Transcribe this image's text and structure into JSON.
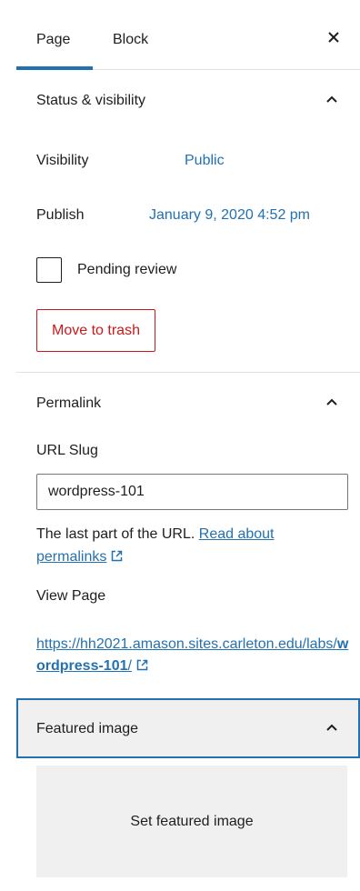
{
  "tabs": {
    "page_label": "Page",
    "block_label": "Block"
  },
  "status_panel": {
    "title": "Status & visibility",
    "visibility_label": "Visibility",
    "visibility_value": "Public",
    "publish_label": "Publish",
    "publish_value": "January 9, 2020 4:52 pm",
    "pending_review_label": "Pending review",
    "pending_review_checked": false,
    "trash_button": "Move to trash"
  },
  "permalink_panel": {
    "title": "Permalink",
    "url_slug_label": "URL Slug",
    "url_slug_value": "wordpress-101",
    "help_text": "The last part of the URL.",
    "help_link": "Read about permalinks",
    "view_page_label": "View Page",
    "url_base": "https://hh2021.amason.sites.carleton.edu/labs/",
    "url_slug": "wordpress-101",
    "url_trailing": "/"
  },
  "featured_panel": {
    "title": "Featured image",
    "set_button": "Set featured image"
  },
  "colors": {
    "accent": "#2271b1",
    "danger": "#cc1818",
    "panel_bg": "#f0f0f0"
  },
  "icons": [
    "close-icon",
    "chevron-up-icon",
    "external-link-icon"
  ]
}
